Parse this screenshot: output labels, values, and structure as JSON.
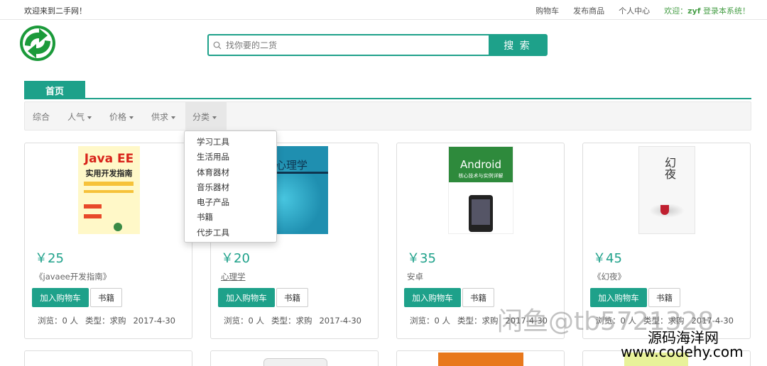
{
  "topbar": {
    "welcome": "欢迎来到二手网！",
    "links": [
      "购物车",
      "发布商品",
      "个人中心"
    ],
    "greeting_prefix": "欢迎：",
    "user": "zyf",
    "greeting_suffix": " 登录本系统！"
  },
  "search": {
    "placeholder": "找你要的二货",
    "button": "搜 索"
  },
  "nav": {
    "home_tab": "首页"
  },
  "filters": [
    {
      "label": "综合",
      "caret": false
    },
    {
      "label": "人气",
      "caret": true
    },
    {
      "label": "价格",
      "caret": true
    },
    {
      "label": "供求",
      "caret": true
    },
    {
      "label": "分类",
      "caret": true,
      "active": true
    }
  ],
  "dropdown_options": [
    "学习工具",
    "生活用品",
    "体育器材",
    "音乐器材",
    "电子产品",
    "书籍",
    "代步工具"
  ],
  "products": [
    {
      "price": "￥25",
      "name": "《javaee开发指南》",
      "add_label": "加入购物车",
      "category": "书籍",
      "views": "浏览：0 人",
      "type": "类型：求购",
      "date": "2017-4-30",
      "cover_title": "Java EE",
      "cover_sub": "实用开发指南"
    },
    {
      "price": "￥20",
      "name": "心理学",
      "add_label": "加入购物车",
      "category": "书籍",
      "views": "浏览：0 人",
      "type": "类型：求购",
      "date": "2017-4-30",
      "cover_title": "心理学"
    },
    {
      "price": "￥35",
      "name": "安卓",
      "add_label": "加入购物车",
      "category": "书籍",
      "views": "浏览：0 人",
      "type": "类型：求购",
      "date": "2017-4-30",
      "cover_title": "Android",
      "cover_sub": "核心技术与实例详解"
    },
    {
      "price": "￥45",
      "name": "《幻夜》",
      "add_label": "加入购物车",
      "category": "书籍",
      "views": "浏览：0 人",
      "type": "类型：求购",
      "date": "2017-4-30",
      "cover_title": "幻夜"
    }
  ],
  "watermarks": {
    "line1": "闲鱼@tb5721328",
    "line2": "源码海洋网",
    "line3": "www.codehy.com"
  },
  "colors": {
    "accent": "#1ea18a",
    "greeting": "#4aa04a"
  }
}
